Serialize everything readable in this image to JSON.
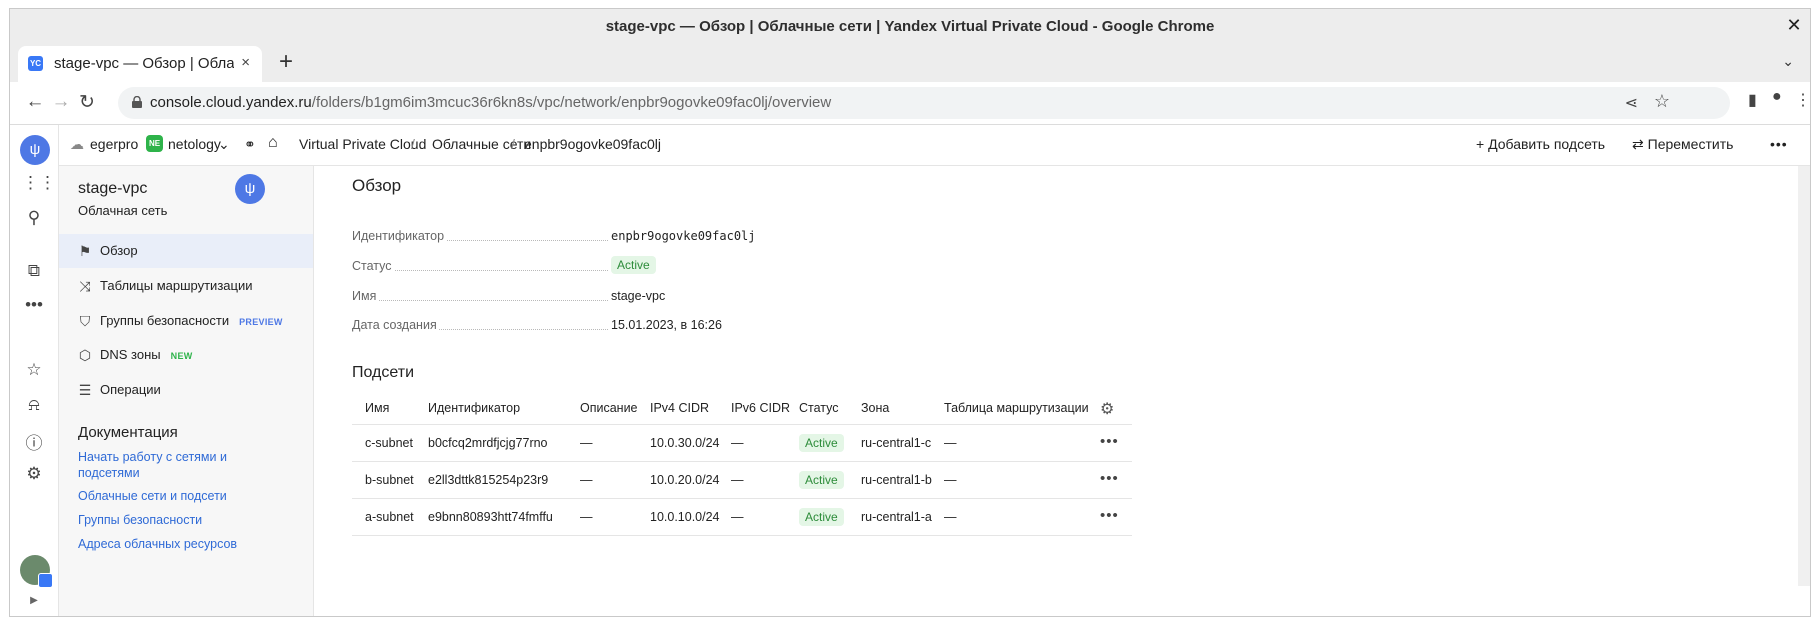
{
  "window": {
    "title": "stage-vpc — Обзор | Облачные сети | Yandex Virtual Private Cloud - Google Chrome",
    "close_glyph": "✕"
  },
  "tab": {
    "favicon_text": "YC",
    "title": "stage-vpc — Обзор | Облачные сети",
    "close_glyph": "×",
    "newtab_glyph": "+"
  },
  "address": {
    "host": "console.cloud.yandex.ru",
    "path": "/folders/b1gm6im3mcuc36r6kn8s/vpc/network/enpbr9ogovke09fac0lj/overview"
  },
  "header": {
    "cloud": "egerpro",
    "folder_badge": "NE",
    "folder": "netology",
    "breadcrumb": [
      "Virtual Private Cloud",
      "Облачные сети",
      "enpbr9ogovke09fac0lj"
    ],
    "separator": "/",
    "add_subnet": "Добавить подсеть",
    "move": "Переместить"
  },
  "sidenav": {
    "title": "stage-vpc",
    "subtitle": "Облачная сеть",
    "items": [
      {
        "label": "Обзор",
        "tag": ""
      },
      {
        "label": "Таблицы маршрутизации",
        "tag": ""
      },
      {
        "label": "Группы безопасности",
        "tag": "PREVIEW"
      },
      {
        "label": "DNS зоны",
        "tag": "NEW"
      },
      {
        "label": "Операции",
        "tag": ""
      }
    ],
    "docs_title": "Документация",
    "docs_links": [
      "Начать работу с сетями и подсетями",
      "Облачные сети и подсети",
      "Группы безопасности",
      "Адреса облачных ресурсов"
    ]
  },
  "overview": {
    "title": "Обзор",
    "fields": [
      {
        "key": "Идентификатор",
        "value": "enpbr9ogovke09fac0lj"
      },
      {
        "key": "Статус",
        "value": "Active"
      },
      {
        "key": "Имя",
        "value": "stage-vpc"
      },
      {
        "key": "Дата создания",
        "value": "15.01.2023, в 16:26"
      }
    ]
  },
  "subnets": {
    "title": "Подсети",
    "columns": [
      "Имя",
      "Идентификатор",
      "Описание",
      "IPv4 CIDR",
      "IPv6 CIDR",
      "Статус",
      "Зона",
      "Таблица маршрутизации"
    ],
    "rows": [
      [
        "c-subnet",
        "b0cfcq2mrdfjcjg77rno",
        "—",
        "10.0.30.0/24",
        "—",
        "Active",
        "ru-central1-c",
        "—"
      ],
      [
        "b-subnet",
        "e2ll3dttk815254p23r9",
        "—",
        "10.0.20.0/24",
        "—",
        "Active",
        "ru-central1-b",
        "—"
      ],
      [
        "a-subnet",
        "e9bnn80893htt74fmffu",
        "—",
        "10.0.10.0/24",
        "—",
        "Active",
        "ru-central1-a",
        "—"
      ]
    ]
  },
  "colors": {
    "accent": "#4e78e5",
    "link": "#2f6ad6",
    "status_green": "#2d8c3a",
    "status_bg": "#e4f6e6",
    "preview_tag": "#4e78e5",
    "new_tag": "#2eb34a"
  }
}
